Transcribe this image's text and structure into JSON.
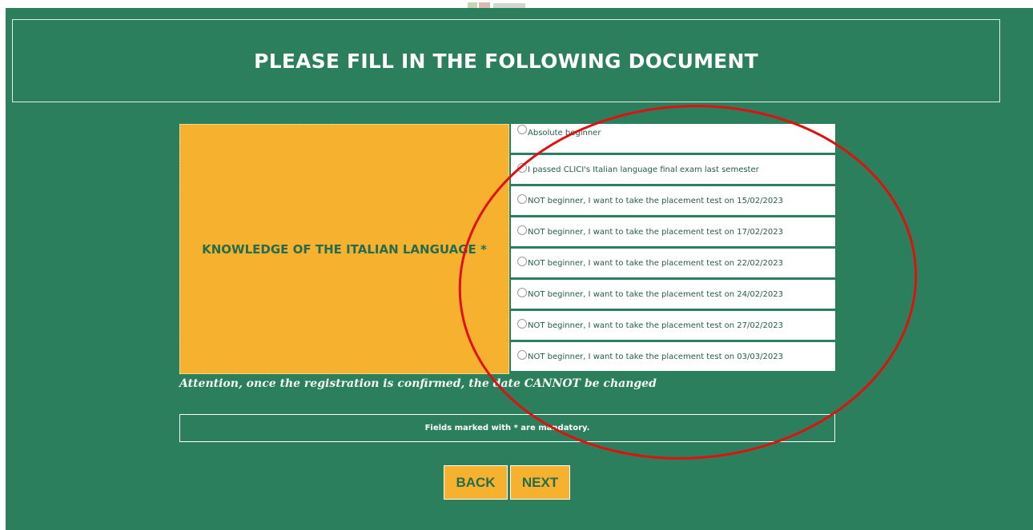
{
  "form": {
    "title": "PLEASE FILL IN THE FOLLOWING DOCUMENT",
    "knowledge_label": "KNOWLEDGE OF THE ITALIAN LANGUAGE *",
    "options": [
      "Absolute beginner",
      "I passed CLICI's Italian language final exam last semester",
      "NOT beginner, I want to take the placement test on 15/02/2023",
      "NOT beginner, I want to take the placement test on 17/02/2023",
      "NOT beginner, I want to take the placement test on 22/02/2023",
      "NOT beginner, I want to take the placement test on 24/02/2023",
      "NOT beginner, I want to take the placement test on 27/02/2023",
      "NOT beginner, I want to take the placement test on 03/03/2023"
    ],
    "attention": "Attention, once the registration is confirmed, the date CANNOT be changed",
    "mandatory_note": "Fields marked with * are mandatory."
  },
  "buttons": {
    "back": "BACK",
    "next": "NEXT"
  },
  "colors": {
    "page_bg": "#2c7f5d",
    "accent": "#f6b22f",
    "label_text": "#256b4d",
    "annotation": "#e01010"
  },
  "annotation": {
    "shape": "ellipse",
    "color": "#e01010"
  }
}
